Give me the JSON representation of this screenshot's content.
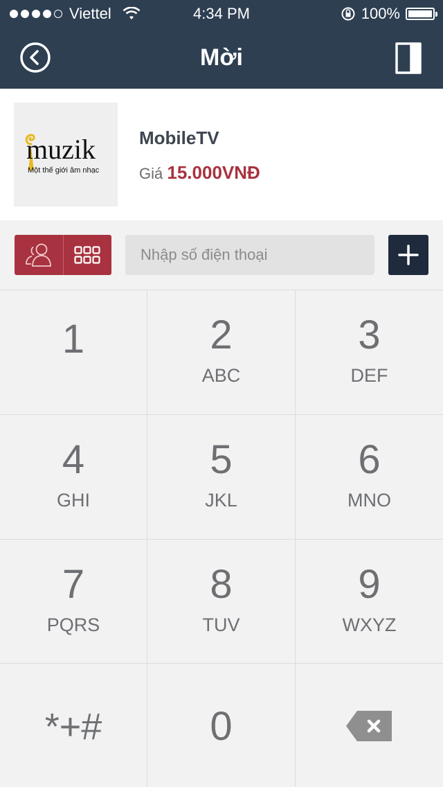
{
  "status_bar": {
    "carrier": "Viettel",
    "time": "4:34 PM",
    "battery": "100%",
    "battery_level": 1.0
  },
  "nav": {
    "title": "Mời"
  },
  "product": {
    "logo_text": "muzik",
    "logo_tagline": "Một thế giới âm nhạc",
    "name": "MobileTV",
    "price_label": "Giá",
    "price_value": "15.000VNĐ"
  },
  "input": {
    "placeholder": "Nhập số điện thoại",
    "value": ""
  },
  "keypad": {
    "keys": [
      {
        "digit": "1",
        "letters": ""
      },
      {
        "digit": "2",
        "letters": "ABC"
      },
      {
        "digit": "3",
        "letters": "DEF"
      },
      {
        "digit": "4",
        "letters": "GHI"
      },
      {
        "digit": "5",
        "letters": "JKL"
      },
      {
        "digit": "6",
        "letters": "MNO"
      },
      {
        "digit": "7",
        "letters": "PQRS"
      },
      {
        "digit": "8",
        "letters": "TUV"
      },
      {
        "digit": "9",
        "letters": "WXYZ"
      }
    ],
    "symbols": "*+#",
    "zero": "0"
  },
  "colors": {
    "header": "#2e3f52",
    "accent_red": "#a8323f",
    "dark_button": "#1f2a3d",
    "keypad_bg": "#f2f2f2"
  }
}
